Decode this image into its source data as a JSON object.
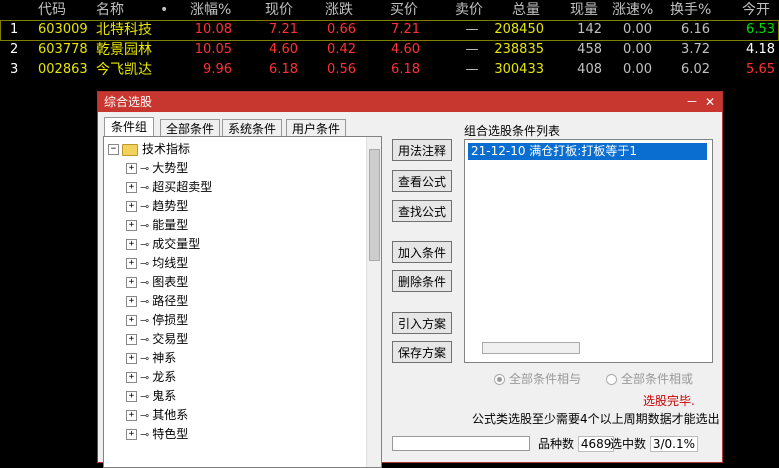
{
  "quote_table": {
    "headers": [
      "代码",
      "名称",
      "•",
      "涨幅%",
      "现价",
      "涨跌",
      "买价",
      "卖价",
      "总量",
      "现量",
      "涨速%",
      "换手%",
      "今开"
    ],
    "rows": [
      {
        "idx": "1",
        "code": "603009",
        "name": "北特科技",
        "pct": "10.08",
        "price": "7.21",
        "chg": "0.66",
        "bid": "7.21",
        "ask": "—",
        "vol": "208450",
        "cur": "142",
        "speed": "0.00",
        "turnover": "6.16",
        "open": "6.53"
      },
      {
        "idx": "2",
        "code": "603778",
        "name": "乾景园林",
        "pct": "10.05",
        "price": "4.60",
        "chg": "0.42",
        "bid": "4.60",
        "ask": "—",
        "vol": "238835",
        "cur": "458",
        "speed": "0.00",
        "turnover": "3.72",
        "open": "4.18"
      },
      {
        "idx": "3",
        "code": "002863",
        "name": "今飞凯达",
        "pct": "9.96",
        "price": "6.18",
        "chg": "0.56",
        "bid": "6.18",
        "ask": "—",
        "vol": "300433",
        "cur": "408",
        "speed": "0.00",
        "turnover": "6.02",
        "open": "5.65"
      }
    ],
    "colors": {
      "code": "#e6e600",
      "name": "#e6e600",
      "up": "#ff3232",
      "vol": "#e6e600",
      "neutral": "#c0c0c0",
      "open_up": "#00e000",
      "open_flat": "#ffffff",
      "open_dn": "#ff3232",
      "selected_row_border": "#808000"
    }
  },
  "dialog": {
    "title": "综合选股",
    "minimize": "－",
    "close": "✕",
    "tabs": [
      "条件组",
      "全部条件",
      "系统条件",
      "用户条件"
    ],
    "tree_root": "技术指标",
    "tree_children": [
      "大势型",
      "超买超卖型",
      "趋势型",
      "能量型",
      "成交量型",
      "均线型",
      "图表型",
      "路径型",
      "停损型",
      "交易型",
      "神系",
      "龙系",
      "鬼系",
      "其他系",
      "特色型"
    ],
    "buttons": [
      "用法注释",
      "查看公式",
      "查找公式",
      "加入条件",
      "删除条件",
      "引入方案",
      "保存方案"
    ],
    "list_label": "组合选股条件列表",
    "list_items": [
      "21-12-10 满仓打板:打板等于1"
    ],
    "radio_and": "全部条件相与",
    "radio_or": "全部条件相或",
    "status": "选股完毕.",
    "note": "公式类选股至少需要4个以上周期数据才能选出",
    "count_label": "品种数",
    "count_value": "4689",
    "selected_label": "选中数",
    "selected_value": "3/0.1%"
  }
}
